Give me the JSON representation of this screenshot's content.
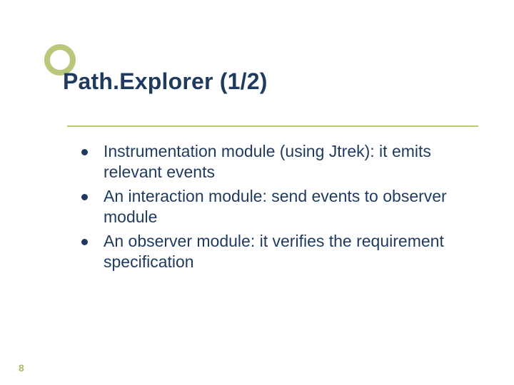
{
  "slide": {
    "title": "Path.Explorer (1/2)",
    "bullets": [
      "Instrumentation module (using Jtrek): it emits relevant events",
      "An interaction module: send events to observer module",
      "An observer module: it verifies the requirement specification"
    ],
    "page_number": "8"
  }
}
